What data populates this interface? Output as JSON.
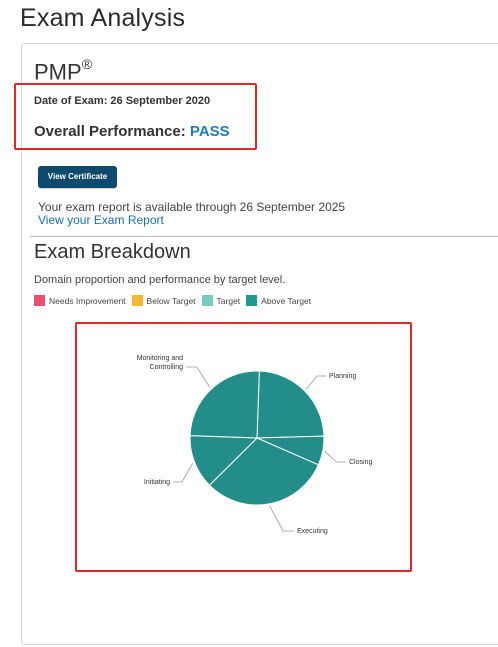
{
  "page": {
    "title": "Exam Analysis"
  },
  "exam": {
    "name": "PMP",
    "trademark": "®",
    "date_line": "Date of Exam: 26 September 2020",
    "performance_label": "Overall Performance:",
    "performance_value": "PASS"
  },
  "actions": {
    "view_certificate": "View Certificate",
    "availability_text": "Your exam report is available through 26 September 2025",
    "report_link": "View your Exam Report"
  },
  "breakdown": {
    "title": "Exam Breakdown",
    "subtitle": "Domain proportion and performance by target level.",
    "legend": [
      {
        "label": "Needs Improvement",
        "color": "#e8506b"
      },
      {
        "label": "Below Target",
        "color": "#f5b731"
      },
      {
        "label": "Target",
        "color": "#79cbbf"
      },
      {
        "label": "Above Target",
        "color": "#1f9a93"
      }
    ]
  },
  "colors": {
    "highlight_border": "#e3282b",
    "pass_text": "#1a7bbd",
    "button_bg": "#0e4a6e",
    "slice_fill": "#238e89"
  },
  "chart_data": {
    "type": "pie",
    "title": "",
    "slices": [
      {
        "name": "Planning",
        "value": 24,
        "level": "Above Target"
      },
      {
        "name": "Closing",
        "value": 7,
        "level": "Above Target"
      },
      {
        "name": "Executing",
        "value": 31,
        "level": "Above Target"
      },
      {
        "name": "Initiating",
        "value": 13,
        "level": "Above Target"
      },
      {
        "name": "Monitoring and Controlling",
        "value": 25,
        "level": "Above Target"
      }
    ]
  }
}
